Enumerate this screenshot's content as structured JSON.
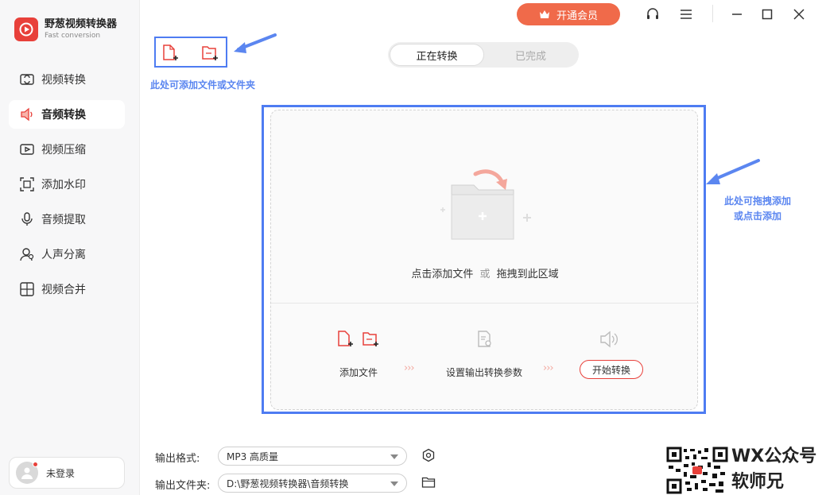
{
  "app": {
    "name": "野葱视频转换器",
    "subtitle": "Fast conversion",
    "brand_color": "#e8403a"
  },
  "titlebar": {
    "vip_label": "开通会员",
    "icons": [
      "headset-icon",
      "menu-icon",
      "minimize-icon",
      "maximize-icon",
      "close-icon"
    ]
  },
  "sidebar": {
    "items": [
      {
        "label": "视频转换",
        "icon": "video-convert-icon"
      },
      {
        "label": "音频转换",
        "icon": "audio-convert-icon",
        "active": true
      },
      {
        "label": "视频压缩",
        "icon": "video-compress-icon"
      },
      {
        "label": "添加水印",
        "icon": "watermark-icon"
      },
      {
        "label": "音频提取",
        "icon": "audio-extract-icon"
      },
      {
        "label": "人声分离",
        "icon": "vocal-separate-icon"
      },
      {
        "label": "视频合并",
        "icon": "video-merge-icon"
      }
    ],
    "user": {
      "label": "未登录"
    }
  },
  "toolbar": {
    "annotation": "此处可添加文件或文件夹",
    "icons": [
      "add-file-icon",
      "add-folder-icon"
    ]
  },
  "tabs": [
    {
      "label": "正在转换",
      "active": true
    },
    {
      "label": "已完成",
      "active": false
    }
  ],
  "dropzone": {
    "hint_main": "点击添加文件",
    "hint_or": "或",
    "hint_drag": "拖拽到此区域",
    "annotation_line1": "此处可拖拽添加",
    "annotation_line2": "或点击添加",
    "steps": {
      "add_files": "添加文件",
      "set_params": "设置输出转换参数",
      "start": "开始转换",
      "arrow": "›››"
    }
  },
  "settings": {
    "format_label": "输出格式:",
    "format_value": "MP3 高质量",
    "folder_label": "输出文件夹:",
    "folder_value": "D:\\野葱视频转换器\\音频转换"
  },
  "watermark": {
    "line1": "WX公众号",
    "line2": "软师兄"
  },
  "colors": {
    "accent": "#e8403a",
    "vip": "#f06a4a",
    "annotation": "#4e7cf2"
  }
}
